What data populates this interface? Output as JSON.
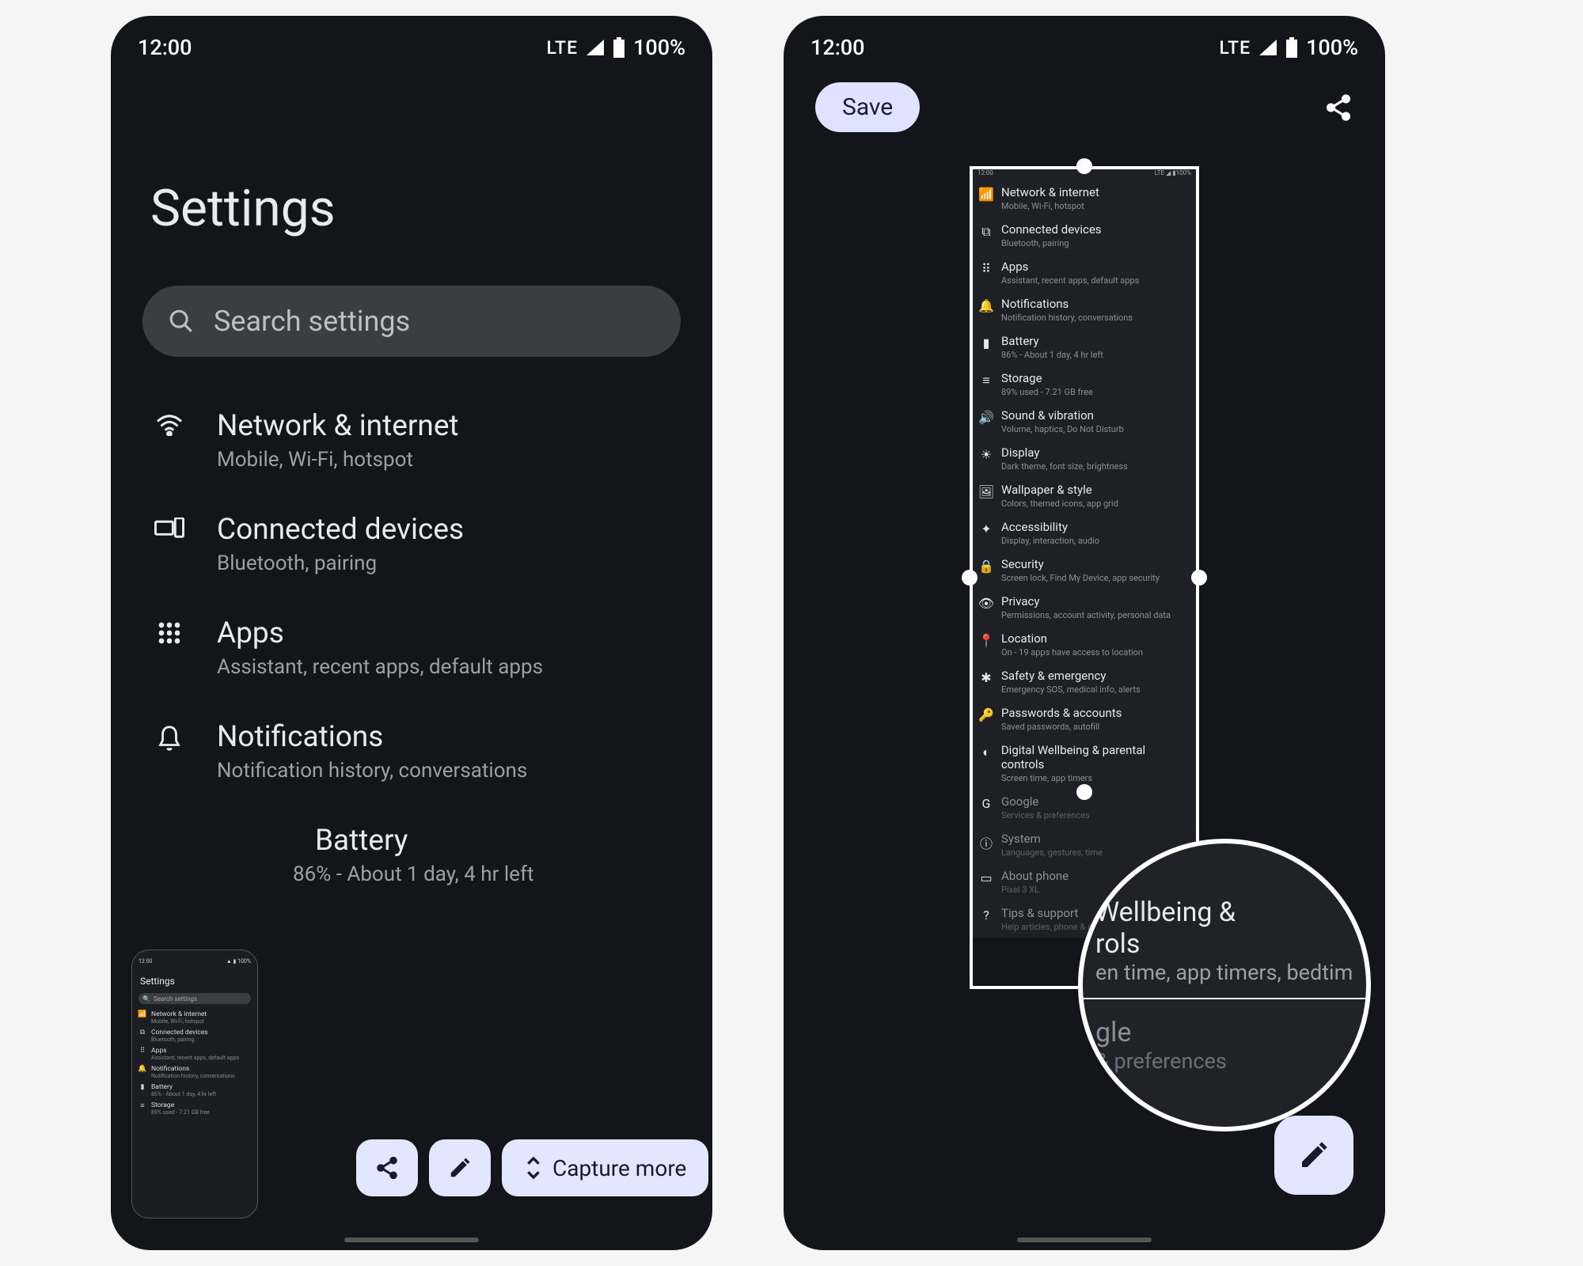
{
  "status": {
    "time": "12:00",
    "network": "LTE",
    "battery": "100%"
  },
  "left": {
    "title": "Settings",
    "search_placeholder": "Search settings",
    "items": [
      {
        "label": "Network & internet",
        "sub": "Mobile, Wi-Fi, hotspot",
        "icon": "wifi"
      },
      {
        "label": "Connected devices",
        "sub": "Bluetooth, pairing",
        "icon": "devices"
      },
      {
        "label": "Apps",
        "sub": "Assistant, recent apps, default apps",
        "icon": "apps"
      },
      {
        "label": "Notifications",
        "sub": "Notification history, conversations",
        "icon": "bell"
      },
      {
        "label": "Battery",
        "sub": "86% - About 1 day, 4 hr left",
        "icon": "battery"
      }
    ],
    "preview": {
      "title": "Settings",
      "search": "Search settings",
      "mini_items": [
        {
          "l": "Network & internet",
          "s": "Mobile, Wi-Fi, hotspot"
        },
        {
          "l": "Connected devices",
          "s": "Bluetooth, pairing"
        },
        {
          "l": "Apps",
          "s": "Assistant, recent apps, default apps"
        },
        {
          "l": "Notifications",
          "s": "Notification history, conversations"
        },
        {
          "l": "Battery",
          "s": "86% - About 1 day, 4 hr left"
        },
        {
          "l": "Storage",
          "s": "89% used - 7.21 GB free"
        }
      ]
    },
    "actions": {
      "capture_more": "Capture more"
    }
  },
  "right": {
    "save": "Save",
    "longshot_items": [
      {
        "l": "Network & internet",
        "s": "Mobile, Wi-Fi, hotspot",
        "icon": "wifi"
      },
      {
        "l": "Connected devices",
        "s": "Bluetooth, pairing",
        "icon": "devices"
      },
      {
        "l": "Apps",
        "s": "Assistant, recent apps, default apps",
        "icon": "apps"
      },
      {
        "l": "Notifications",
        "s": "Notification history, conversations",
        "icon": "bell"
      },
      {
        "l": "Battery",
        "s": "86% - About 1 day, 4 hr left",
        "icon": "battery"
      },
      {
        "l": "Storage",
        "s": "89% used - 7.21 GB free",
        "icon": "storage"
      },
      {
        "l": "Sound & vibration",
        "s": "Volume, haptics, Do Not Disturb",
        "icon": "sound"
      },
      {
        "l": "Display",
        "s": "Dark theme, font size, brightness",
        "icon": "display"
      },
      {
        "l": "Wallpaper & style",
        "s": "Colors, themed icons, app grid",
        "icon": "wallpaper"
      },
      {
        "l": "Accessibility",
        "s": "Display, interaction, audio",
        "icon": "accessibility"
      },
      {
        "l": "Security",
        "s": "Screen lock, Find My Device, app security",
        "icon": "lock"
      },
      {
        "l": "Privacy",
        "s": "Permissions, account activity, personal data",
        "icon": "privacy"
      },
      {
        "l": "Location",
        "s": "On - 19 apps have access to location",
        "icon": "location"
      },
      {
        "l": "Safety & emergency",
        "s": "Emergency SOS, medical info, alerts",
        "icon": "safety"
      },
      {
        "l": "Passwords & accounts",
        "s": "Saved passwords, autofill",
        "icon": "passwords"
      },
      {
        "l": "Digital Wellbeing & parental controls",
        "s": "Screen time, app timers",
        "icon": "wellbeing"
      }
    ],
    "longshot_dimmed": [
      {
        "l": "Google",
        "s": "Services & preferences",
        "icon": "google"
      },
      {
        "l": "System",
        "s": "Languages, gestures, time",
        "icon": "system"
      },
      {
        "l": "About phone",
        "s": "Pixel 3 XL",
        "icon": "about"
      },
      {
        "l": "Tips & support",
        "s": "Help articles, phone & chat",
        "icon": "tips"
      }
    ],
    "magnifier": {
      "top_l": "Wellbeing &",
      "top_l2": "rols",
      "top_s": "en time, app timers, bedtim",
      "bot_l": "gle",
      "bot_s": "& preferences"
    }
  }
}
